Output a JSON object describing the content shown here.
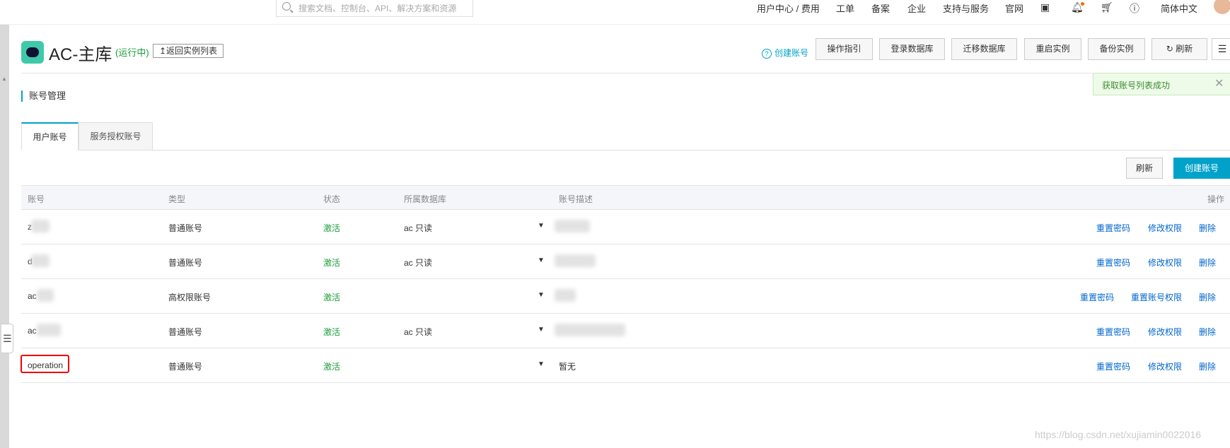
{
  "topbar": {
    "search_placeholder": "搜索文档、控制台、API、解决方案和资源",
    "nav": [
      "用户中心 / 费用",
      "工单",
      "备案",
      "企业",
      "支持与服务",
      "官网"
    ],
    "lang": "简体中文"
  },
  "header": {
    "title": "AC-主库",
    "status": "(运行中)",
    "back": "返回实例列表",
    "help": "创建账号",
    "buttons": [
      "操作指引",
      "登录数据库",
      "迁移数据库",
      "重启实例",
      "备份实例",
      "刷新"
    ]
  },
  "section": {
    "title": "账号管理"
  },
  "toast": {
    "message": "获取账号列表成功"
  },
  "tabs": [
    "用户账号",
    "服务授权账号"
  ],
  "toolbar": {
    "refresh": "刷新",
    "create": "创建账号"
  },
  "table": {
    "headers": [
      "账号",
      "类型",
      "状态",
      "所属数据库",
      "账号描述",
      "操作"
    ],
    "rows": [
      {
        "account": "z",
        "type": "普通账号",
        "status": "激活",
        "db": "ac 只读",
        "desc": "",
        "actions": [
          "重置密码",
          "修改权限",
          "删除"
        ]
      },
      {
        "account": "d",
        "type": "普通账号",
        "status": "激活",
        "db": "ac 只读",
        "desc": "",
        "actions": [
          "重置密码",
          "修改权限",
          "删除"
        ]
      },
      {
        "account": "ac",
        "type": "高权限账号",
        "status": "激活",
        "db": "",
        "desc": "",
        "actions": [
          "重置密码",
          "重置账号权限",
          "删除"
        ]
      },
      {
        "account": "ac",
        "type": "普通账号",
        "status": "激活",
        "db": "ac 只读",
        "desc": "",
        "actions": [
          "重置密码",
          "修改权限",
          "删除"
        ]
      },
      {
        "account": "operation",
        "type": "普通账号",
        "status": "激活",
        "db": "",
        "desc": "暂无",
        "actions": [
          "重置密码",
          "修改权限",
          "删除"
        ]
      }
    ]
  },
  "watermark": "https://blog.csdn.net/xujiamin0022016",
  "colors": {
    "accent": "#00a2ca",
    "success": "#1c9d3a",
    "link": "#0066cc",
    "highlight": "#e00000"
  }
}
